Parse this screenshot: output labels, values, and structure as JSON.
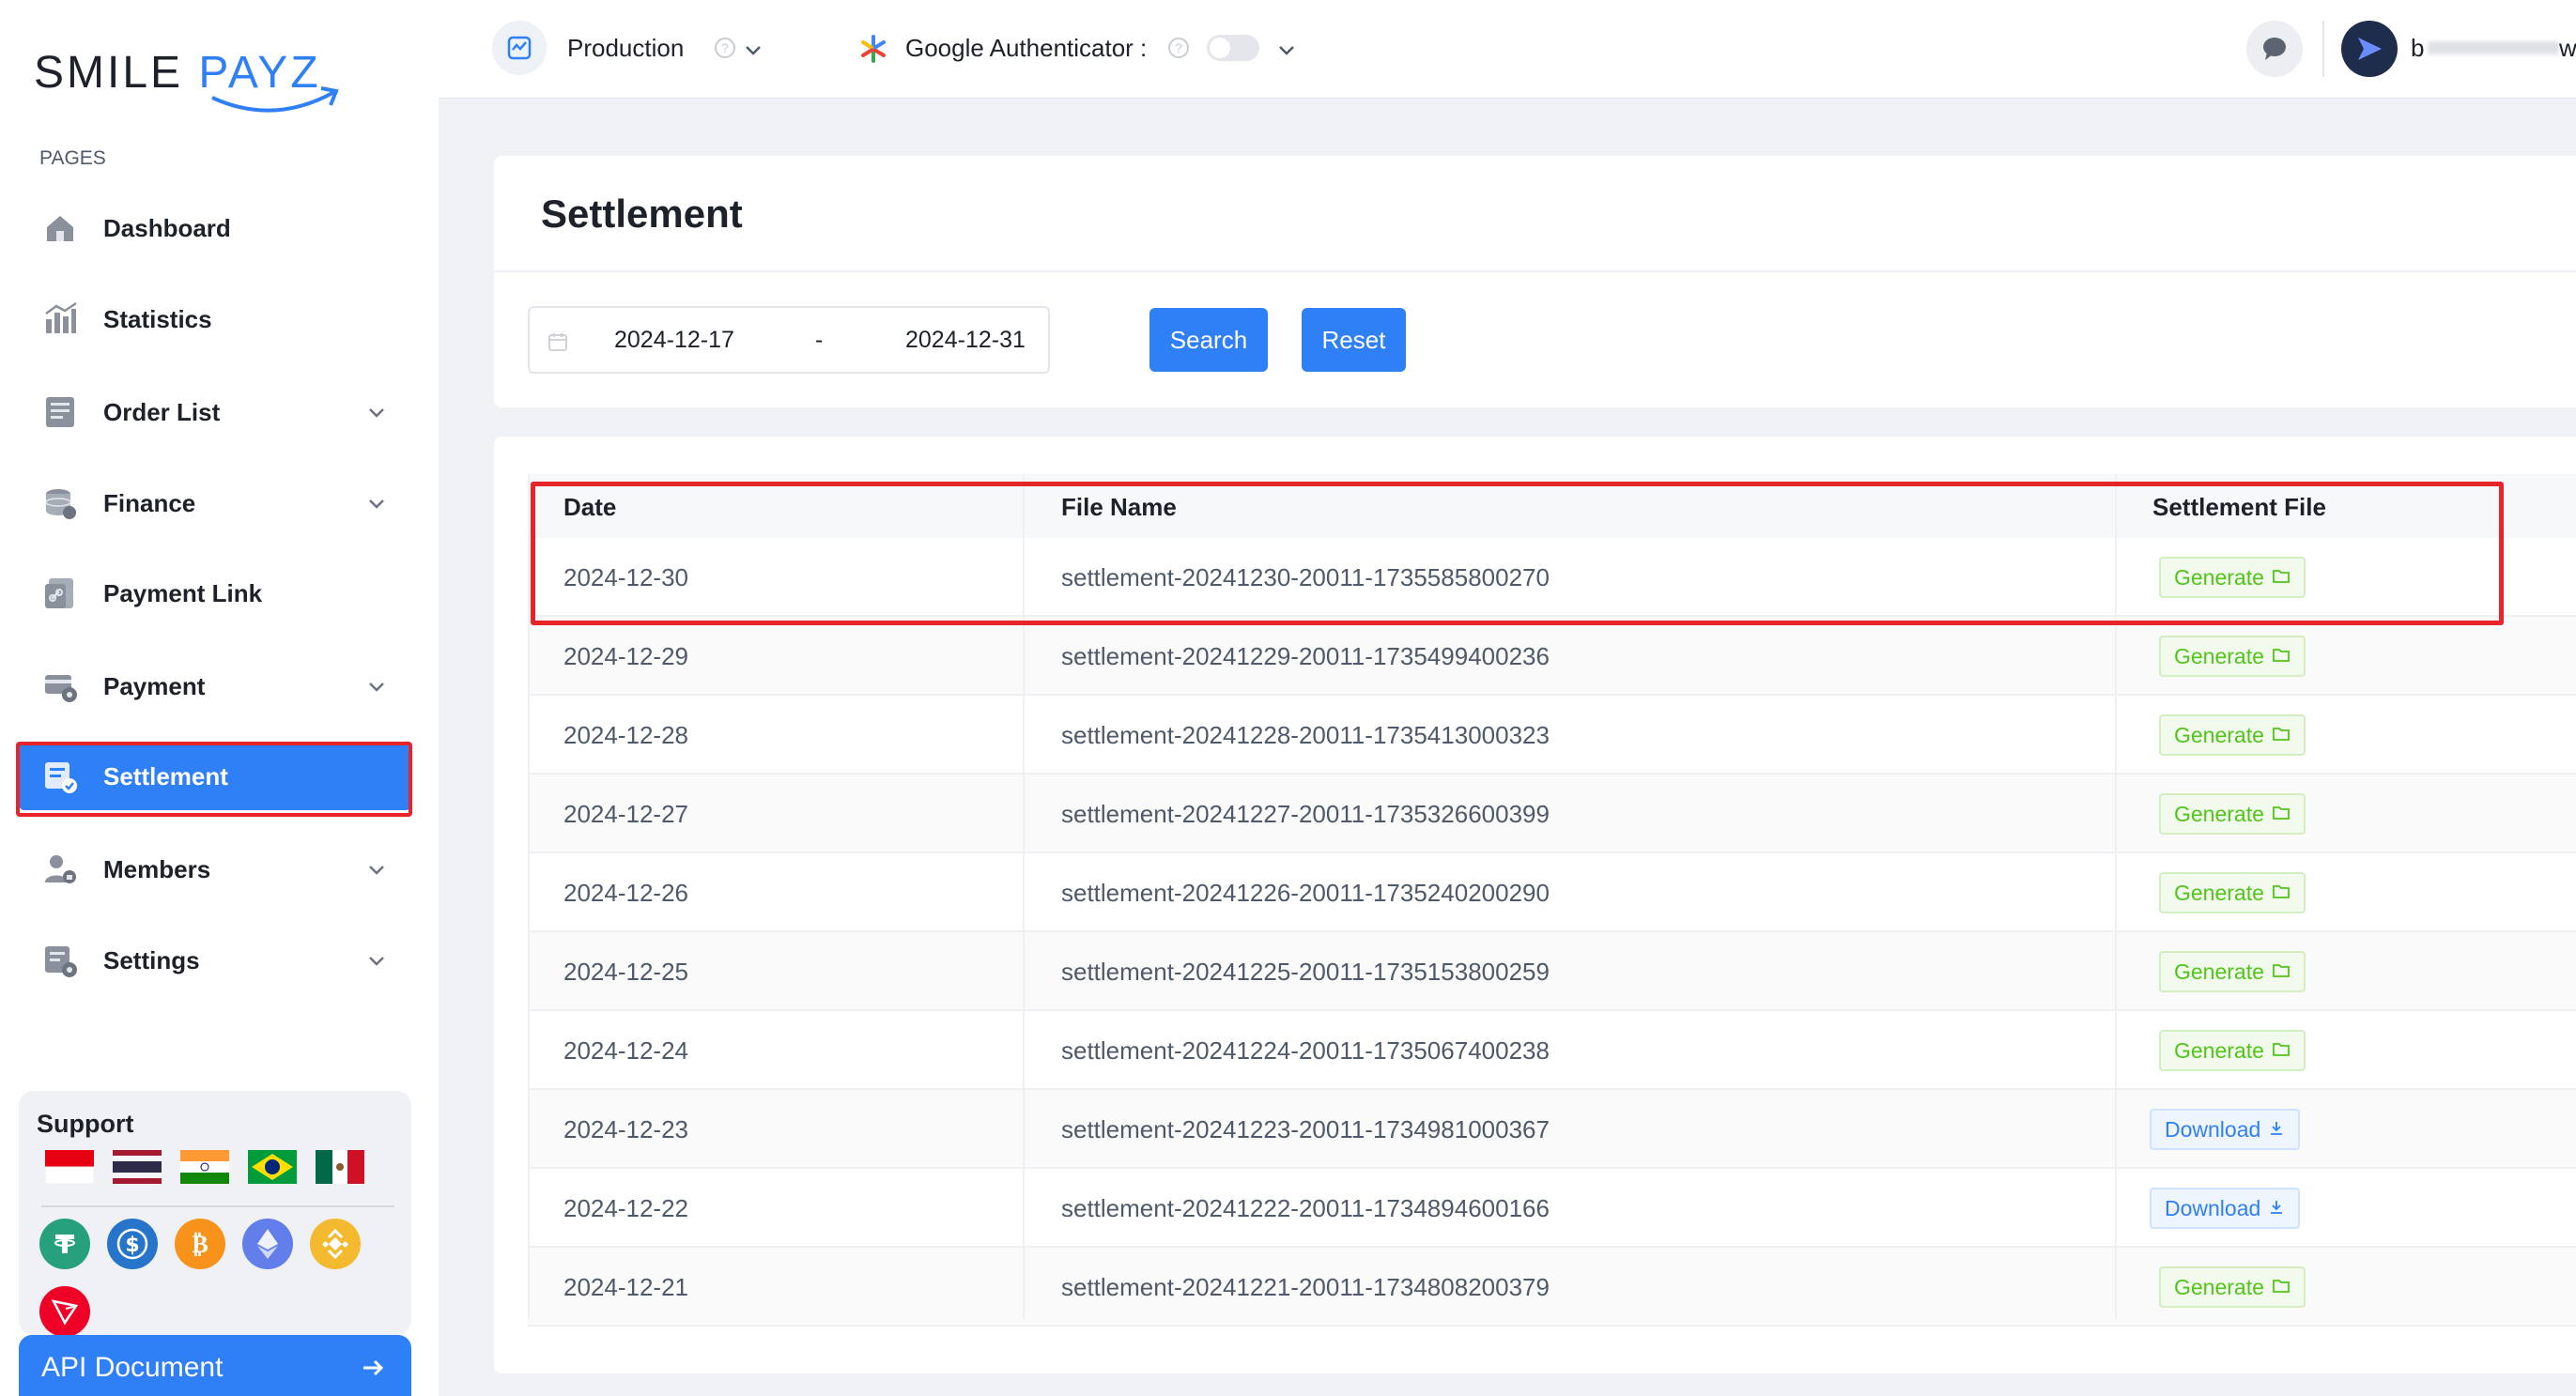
{
  "brand": {
    "logo_part1": "SMILE",
    "logo_part2": "PAYZ",
    "accent": "#2f7ff7"
  },
  "sidebar": {
    "section_label": "PAGES",
    "items": [
      {
        "label": "Dashboard",
        "icon": "home-icon",
        "has_chevron": false,
        "active": false
      },
      {
        "label": "Statistics",
        "icon": "bar-chart-icon",
        "has_chevron": false,
        "active": false
      },
      {
        "label": "Order List",
        "icon": "list-icon",
        "has_chevron": true,
        "active": false
      },
      {
        "label": "Finance",
        "icon": "coins-icon",
        "has_chevron": true,
        "active": false
      },
      {
        "label": "Payment Link",
        "icon": "link-icon",
        "has_chevron": false,
        "active": false
      },
      {
        "label": "Payment",
        "icon": "payment-icon",
        "has_chevron": true,
        "active": false
      },
      {
        "label": "Settlement",
        "icon": "settlement-icon",
        "has_chevron": false,
        "active": true
      },
      {
        "label": "Members",
        "icon": "members-icon",
        "has_chevron": true,
        "active": false
      },
      {
        "label": "Settings",
        "icon": "settings-icon",
        "has_chevron": true,
        "active": false
      }
    ],
    "support": {
      "title": "Support",
      "flags": [
        "indonesia-flag-icon",
        "thailand-flag-icon",
        "india-flag-icon",
        "brazil-flag-icon",
        "mexico-flag-icon"
      ],
      "coins": [
        "tether-icon",
        "usdc-icon",
        "bitcoin-icon",
        "ethereum-icon",
        "bnb-icon",
        "tron-icon"
      ]
    },
    "api_button": "API Document"
  },
  "topbar": {
    "environment": "Production",
    "authenticator_label": "Google Authenticator :",
    "authenticator_enabled": false,
    "user_initial": "b",
    "user_suffix": "w"
  },
  "page": {
    "title": "Settlement",
    "date_from": "2024-12-17",
    "date_separator": "-",
    "date_to": "2024-12-31",
    "search_label": "Search",
    "reset_label": "Reset"
  },
  "table": {
    "columns": [
      "Date",
      "File Name",
      "Settlement File"
    ],
    "rows": [
      {
        "date": "2024-12-30",
        "file": "settlement-20241230-20011-1735585800270",
        "action": "Generate"
      },
      {
        "date": "2024-12-29",
        "file": "settlement-20241229-20011-1735499400236",
        "action": "Generate"
      },
      {
        "date": "2024-12-28",
        "file": "settlement-20241228-20011-1735413000323",
        "action": "Generate"
      },
      {
        "date": "2024-12-27",
        "file": "settlement-20241227-20011-1735326600399",
        "action": "Generate"
      },
      {
        "date": "2024-12-26",
        "file": "settlement-20241226-20011-1735240200290",
        "action": "Generate"
      },
      {
        "date": "2024-12-25",
        "file": "settlement-20241225-20011-1735153800259",
        "action": "Generate"
      },
      {
        "date": "2024-12-24",
        "file": "settlement-20241224-20011-1735067400238",
        "action": "Generate"
      },
      {
        "date": "2024-12-23",
        "file": "settlement-20241223-20011-1734981000367",
        "action": "Download"
      },
      {
        "date": "2024-12-22",
        "file": "settlement-20241222-20011-1734894600166",
        "action": "Download"
      },
      {
        "date": "2024-12-21",
        "file": "settlement-20241221-20011-1734808200379",
        "action": "Generate"
      }
    ]
  },
  "colors": {
    "primary": "#2f7ff7",
    "generate": "#52c41a",
    "highlight": "#e8242b"
  }
}
